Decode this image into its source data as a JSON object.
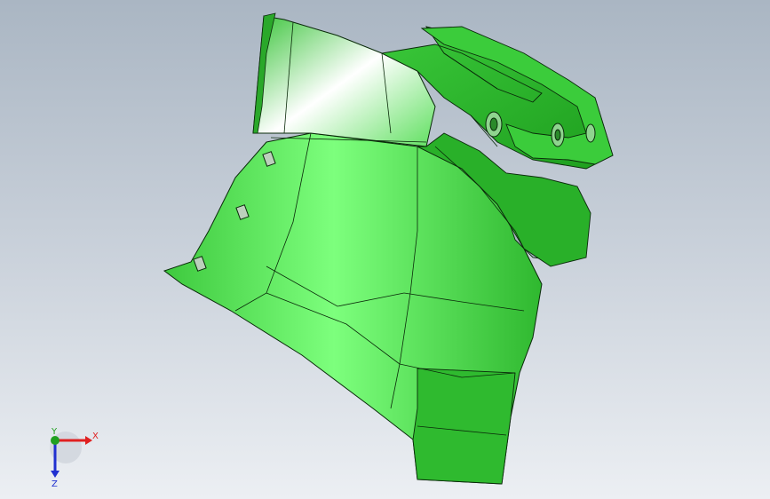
{
  "viewport": {
    "background_top": "#aab6c3",
    "background_bottom": "#eceff3"
  },
  "model": {
    "fill_color": "#33c633",
    "highlight_color": "#7dff7d",
    "edge_color": "#0a2a0a"
  },
  "triad": {
    "x_label": "X",
    "y_label": "Y",
    "z_label": "Z",
    "x_color": "#e02020",
    "y_color": "#20a020",
    "z_color": "#2030d0"
  }
}
